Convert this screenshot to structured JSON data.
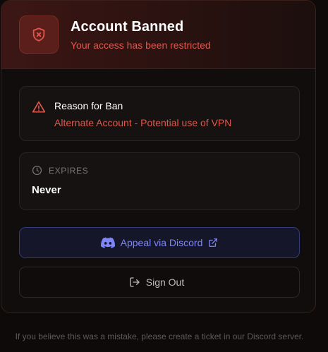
{
  "header": {
    "icon": "shield-x-icon",
    "title": "Account Banned",
    "subtitle": "Your access has been restricted"
  },
  "reason": {
    "icon": "warning-triangle-icon",
    "title": "Reason for Ban",
    "value": "Alternate Account - Potential use of VPN"
  },
  "expires": {
    "icon": "clock-icon",
    "label": "EXPIRES",
    "value": "Never"
  },
  "buttons": {
    "appeal": {
      "label": "Appeal via Discord",
      "icon": "discord-icon",
      "trailing_icon": "external-link-icon"
    },
    "sign_out": {
      "label": "Sign Out",
      "icon": "sign-out-icon"
    }
  },
  "footer": {
    "note": "If you believe this was a mistake, please create a ticket in our Discord server."
  },
  "colors": {
    "accent_red": "#e2574c",
    "discord_purple": "#7e86f5",
    "background": "#0d0a09"
  }
}
